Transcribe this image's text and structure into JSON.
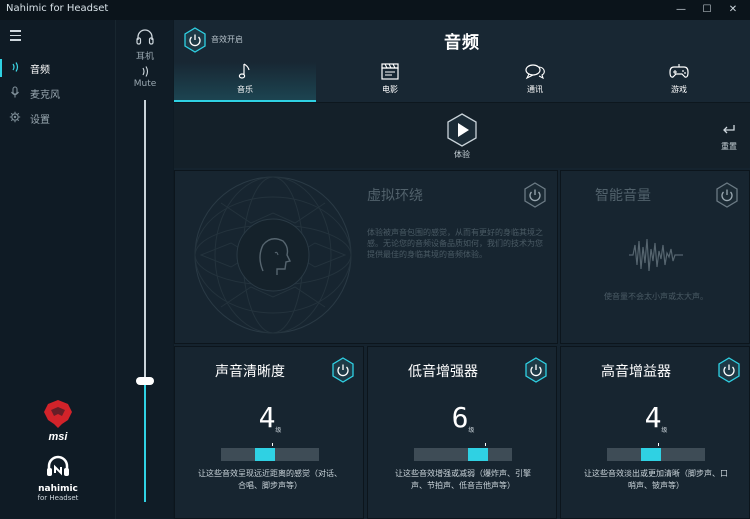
{
  "window": {
    "title": "Nahimic for Headset",
    "minimize": "—",
    "maximize": "☐",
    "close": "✕"
  },
  "sidebar": {
    "items": [
      {
        "label": "音频",
        "icon": "audio-wave-icon",
        "active": true
      },
      {
        "label": "麦克风",
        "icon": "microphone-icon",
        "active": false
      },
      {
        "label": "设置",
        "icon": "gear-icon",
        "active": false
      }
    ],
    "brand_name": "nahimic",
    "brand_sub": "for Headset"
  },
  "device": {
    "output_label": "耳机",
    "mute_label": "Mute",
    "volume_fraction": 0.3
  },
  "main": {
    "effect_toggle_label": "音效开启",
    "title": "音频",
    "tabs": [
      {
        "label": "音乐",
        "icon": "music-note-icon",
        "active": true
      },
      {
        "label": "电影",
        "icon": "clapperboard-icon",
        "active": false
      },
      {
        "label": "通讯",
        "icon": "chat-bubble-icon",
        "active": false
      },
      {
        "label": "游戏",
        "icon": "gamepad-icon",
        "active": false
      }
    ],
    "demo_label": "体验",
    "reset_label": "重置"
  },
  "virtual_surround": {
    "title": "虚拟环绕",
    "desc": "体验被声音包围的感觉，从而有更好的身临其境之感。无论您的音频设备品质如何，我们的技术为您提供最佳的身临其境的音频体验。"
  },
  "smart_volume": {
    "title": "智能音量",
    "desc": "使音量不会太小声或太大声。"
  },
  "effects": [
    {
      "name": "声音清晰度",
      "level": "4",
      "unit": "级",
      "fraction": 0.45,
      "desc": "让这些音效呈现远近距离的感觉（对话、合唱、脚步声等）"
    },
    {
      "name": "低音增强器",
      "level": "6",
      "unit": "级",
      "fraction": 0.65,
      "desc": "让这些音效增强或减弱（爆炸声、引擎声、节拍声、低音吉他声等）"
    },
    {
      "name": "高音增益器",
      "level": "4",
      "unit": "级",
      "fraction": 0.45,
      "desc": "让这些音效淡出或更加清晰（脚步声、口哨声、铍声等）"
    }
  ],
  "colors": {
    "accent": "#2fd1e3",
    "background": "#15232e",
    "msi_red": "#d2232a"
  }
}
